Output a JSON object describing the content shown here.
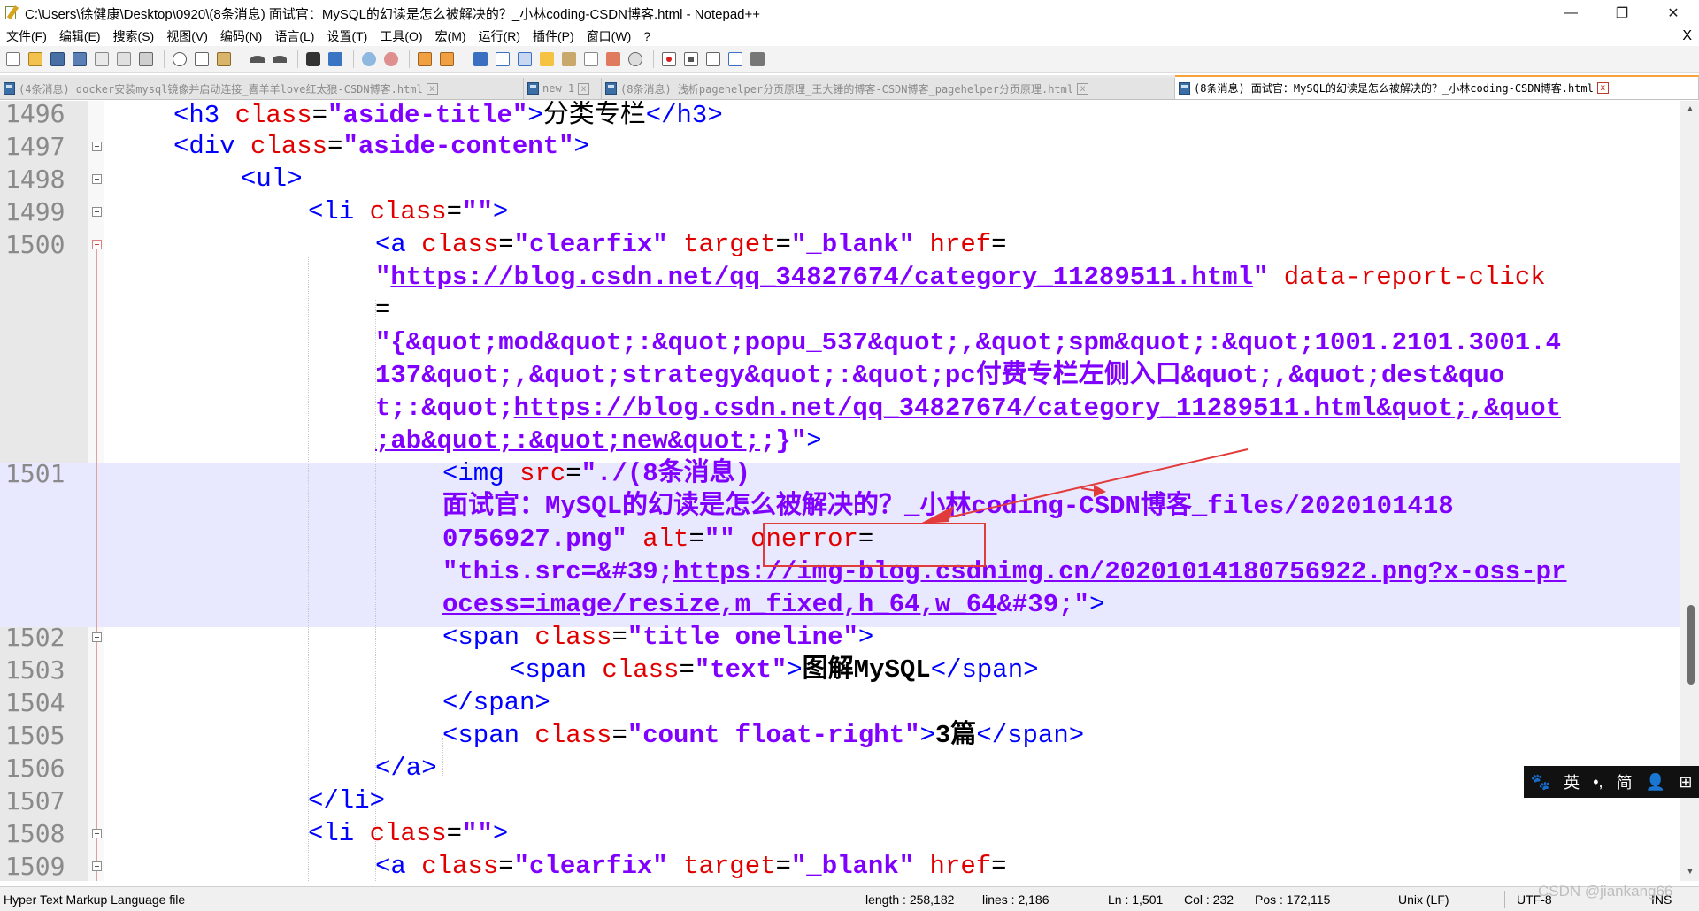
{
  "window": {
    "title": "C:\\Users\\徐健康\\Desktop\\0920\\(8条消息) 面试官：MySQL的幻读是怎么被解决的？_小林coding-CSDN博客.html - Notepad++",
    "minimize": "—",
    "maximize": "❐",
    "close": "✕"
  },
  "menu": {
    "items": [
      "文件(F)",
      "编辑(E)",
      "搜索(S)",
      "视图(V)",
      "编码(N)",
      "语言(L)",
      "设置(T)",
      "工具(O)",
      "宏(M)",
      "运行(R)",
      "插件(P)",
      "窗口(W)",
      "?"
    ],
    "close": "X"
  },
  "toolbar": {
    "icons": [
      "new-file-icon",
      "open-file-icon",
      "save-icon",
      "save-all-icon",
      "close-icon",
      "close-all-icon",
      "print-icon",
      "cut-icon",
      "copy-icon",
      "paste-icon",
      "undo-icon",
      "redo-icon",
      "find-icon",
      "replace-icon",
      "zoom-in-icon",
      "zoom-out-icon",
      "sync-vertical-icon",
      "sync-horizontal-icon",
      "word-wrap-icon",
      "show-all-chars-icon",
      "indent-guide-icon",
      "user-lang-icon",
      "doc-map-icon",
      "function-list-icon",
      "folder-workspace-icon",
      "monitor-icon",
      "record-macro-icon",
      "stop-macro-icon",
      "play-macro-icon",
      "run-macro-multiple-icon",
      "save-macro-icon"
    ]
  },
  "tabs": [
    {
      "label": "(4条消息) docker安装mysql镜像并启动连接_喜羊羊love红太狼-CSDN博客.html",
      "active": false
    },
    {
      "label": "new 1",
      "active": false
    },
    {
      "label": "(8条消息) 浅析pagehelper分页原理_王大锤的博客-CSDN博客_pagehelper分页原理.html",
      "active": false
    },
    {
      "label": "(8条消息) 面试官：MySQL的幻读是怎么被解决的？_小林coding-CSDN博客.html",
      "active": true
    }
  ],
  "editor": {
    "line_numbers": [
      "1496",
      "1497",
      "1498",
      "1499",
      "1500",
      "1501",
      "1502",
      "1503",
      "1504",
      "1505",
      "1506",
      "1507",
      "1508",
      "1509"
    ]
  },
  "ime": {
    "paw": "🐾",
    "lang": "英",
    "punct": "•,",
    "simp": "简",
    "user": "👤",
    "grid": "⊞"
  },
  "status": {
    "file_type": "Hyper Text Markup Language file",
    "length": "length : 258,182",
    "lines": "lines : 2,186",
    "ln": "Ln : 1,501",
    "col": "Col : 232",
    "pos": "Pos : 172,115",
    "eol": "Unix (LF)",
    "encoding": "UTF-8",
    "mode": "INS"
  },
  "watermark": "CSDN @jiankang66"
}
